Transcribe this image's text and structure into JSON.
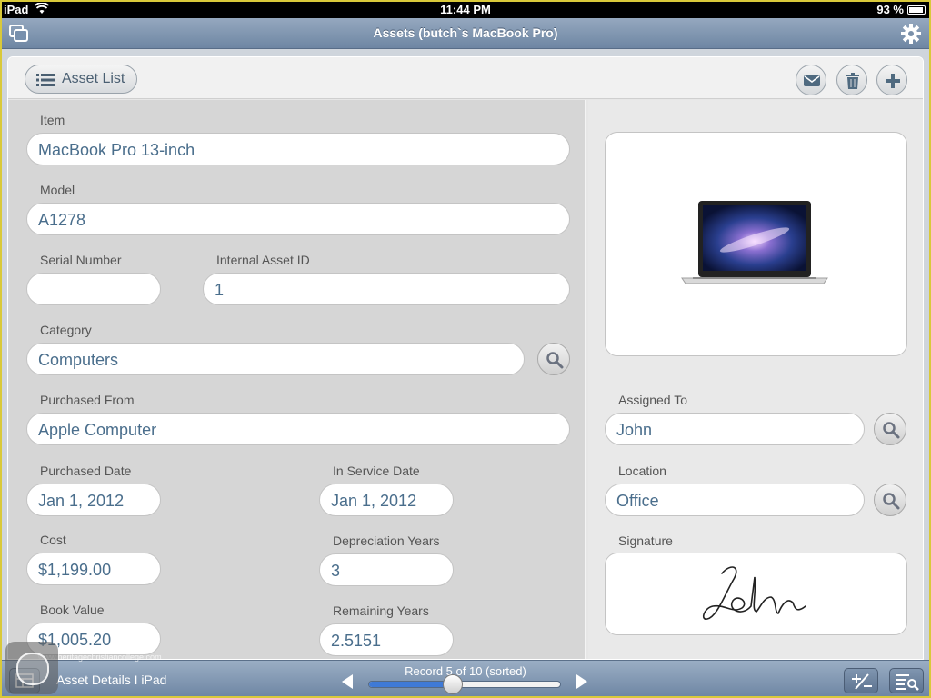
{
  "status_bar": {
    "carrier": "iPad",
    "time": "11:44 PM",
    "battery": "93 %"
  },
  "title_bar": {
    "title": "Assets (butch`s MacBook Pro)"
  },
  "toolbar": {
    "asset_list_label": "Asset List"
  },
  "form": {
    "item": {
      "label": "Item",
      "value": "MacBook Pro 13-inch"
    },
    "model": {
      "label": "Model",
      "value": "A1278"
    },
    "serial": {
      "label": "Serial Number",
      "value": ""
    },
    "internal_id": {
      "label": "Internal Asset ID",
      "value": "1"
    },
    "category": {
      "label": "Category",
      "value": "Computers"
    },
    "purchased_from": {
      "label": "Purchased From",
      "value": "Apple Computer"
    },
    "purchased_date": {
      "label": "Purchased Date",
      "value": "Jan 1, 2012"
    },
    "in_service_date": {
      "label": "In Service Date",
      "value": "Jan 1, 2012"
    },
    "cost": {
      "label": "Cost",
      "value": "$1,199.00"
    },
    "depreciation_years": {
      "label": "Depreciation Years",
      "value": "3"
    },
    "book_value": {
      "label": "Book Value",
      "value": "$1,005.20"
    },
    "remaining_years": {
      "label": "Remaining Years",
      "value": "2.5151"
    },
    "assigned_to": {
      "label": "Assigned To",
      "value": "John"
    },
    "location": {
      "label": "Location",
      "value": "Office"
    },
    "signature": {
      "label": "Signature",
      "value": "John"
    }
  },
  "bottom_bar": {
    "app_label": "Asset Details I iPad",
    "record_text": "Record 5 of 10 (sorted)",
    "record_progress": 0.44
  },
  "watermark": "www.heritagechristiancollege.com",
  "colors": {
    "field_text": "#4a6e8c",
    "bar_top": "#9aaec4",
    "bar_bottom": "#6f87a4",
    "slider_fill": "#3f7ad6"
  }
}
